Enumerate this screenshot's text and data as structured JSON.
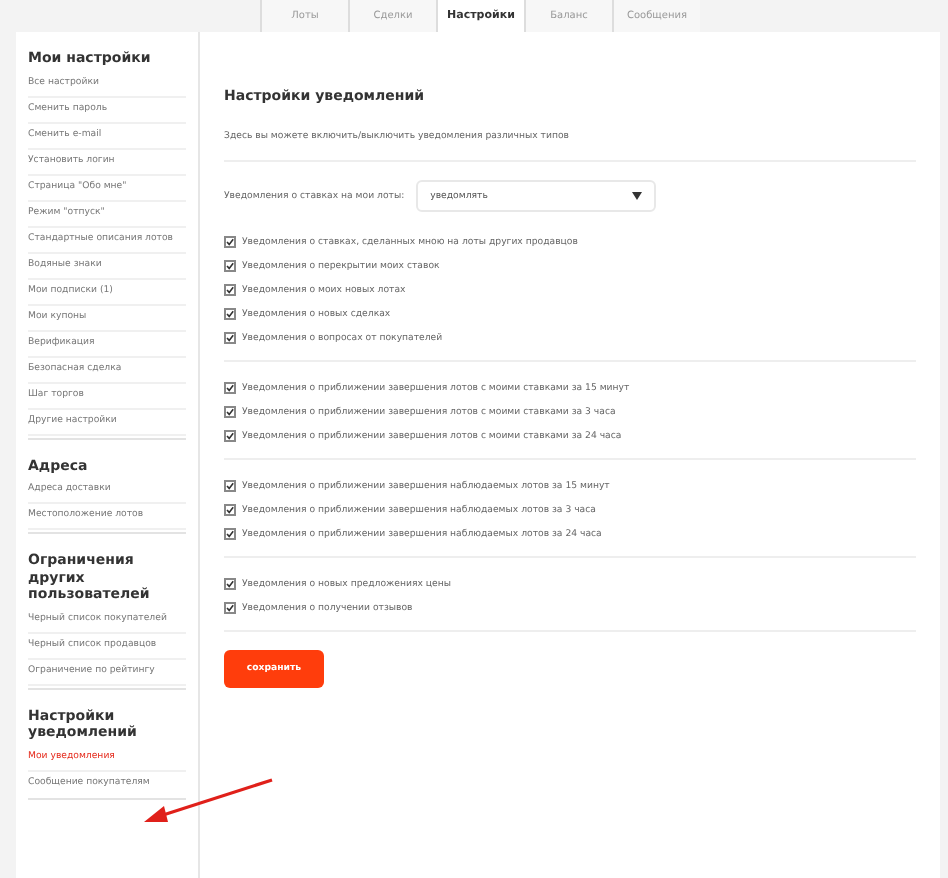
{
  "tabs": [
    {
      "label": "Лоты",
      "selected": false
    },
    {
      "label": "Сделки",
      "selected": false
    },
    {
      "label": "Настройки",
      "selected": true
    },
    {
      "label": "Баланс",
      "selected": false
    },
    {
      "label": "Сообщения",
      "selected": false
    }
  ],
  "sidebar": {
    "sections": [
      {
        "title": "Мои настройки",
        "items": [
          {
            "label": "Все настройки",
            "selected": false
          },
          {
            "label": "Сменить пароль",
            "selected": false
          },
          {
            "label": "Сменить e-mail",
            "selected": false
          },
          {
            "label": "Установить логин",
            "selected": false
          },
          {
            "label": "Страница \"Обо мне\"",
            "selected": false
          },
          {
            "label": "Режим \"отпуск\"",
            "selected": false
          },
          {
            "label": "Стандартные описания лотов",
            "selected": false
          },
          {
            "label": "Водяные знаки",
            "selected": false
          },
          {
            "label": "Мои подписки (1)",
            "selected": false
          },
          {
            "label": "Мои купоны",
            "selected": false
          },
          {
            "label": "Верификация",
            "selected": false
          },
          {
            "label": "Безопасная сделка",
            "selected": false
          },
          {
            "label": "Шаг торгов",
            "selected": false
          },
          {
            "label": "Другие настройки",
            "selected": false
          }
        ]
      },
      {
        "title": "Адреса",
        "items": [
          {
            "label": "Адреса доставки",
            "selected": false
          },
          {
            "label": "Местоположение лотов",
            "selected": false
          }
        ]
      },
      {
        "title": "Ограничения других пользователей",
        "items": [
          {
            "label": "Черный список покупателей",
            "selected": false
          },
          {
            "label": "Черный список продавцов",
            "selected": false
          },
          {
            "label": "Ограничение по рейтингу",
            "selected": false
          }
        ]
      },
      {
        "title": "Настройки уведомлений",
        "items": [
          {
            "label": "Мои уведомления",
            "selected": true
          },
          {
            "label": "Сообщение покупателям",
            "selected": false
          }
        ]
      }
    ]
  },
  "main": {
    "title": "Настройки уведомлений",
    "description": "Здесь вы можете включить/выключить уведомления различных типов",
    "select": {
      "label": "Уведомления о ставках на мои лоты:",
      "value": "уведомлять"
    },
    "groups": [
      [
        {
          "label": "Уведомления о ставках, сделанных мною на лоты других продавцов",
          "checked": true
        },
        {
          "label": "Уведомления о перекрытии моих ставок",
          "checked": true
        },
        {
          "label": "Уведомления о моих новых лотах",
          "checked": true
        },
        {
          "label": "Уведомления о новых сделках",
          "checked": true
        },
        {
          "label": "Уведомления о вопросах от покупателей",
          "checked": true
        }
      ],
      [
        {
          "label": "Уведомления о приближении завершения лотов с моими ставками за 15 минут",
          "checked": true
        },
        {
          "label": "Уведомления о приближении завершения лотов с моими ставками за 3 часа",
          "checked": true
        },
        {
          "label": "Уведомления о приближении завершения лотов с моими ставками за 24 часа",
          "checked": true
        }
      ],
      [
        {
          "label": "Уведомления о приближении завершения наблюдаемых лотов за 15 минут",
          "checked": true
        },
        {
          "label": "Уведомления о приближении завершения наблюдаемых лотов за 3 часа",
          "checked": true
        },
        {
          "label": "Уведомления о приближении завершения наблюдаемых лотов за 24 часа",
          "checked": true
        }
      ],
      [
        {
          "label": "Уведомления о новых предложениях цены",
          "checked": true
        },
        {
          "label": "Уведомления о получении отзывов",
          "checked": true
        }
      ]
    ],
    "save_button": "сохранить"
  }
}
